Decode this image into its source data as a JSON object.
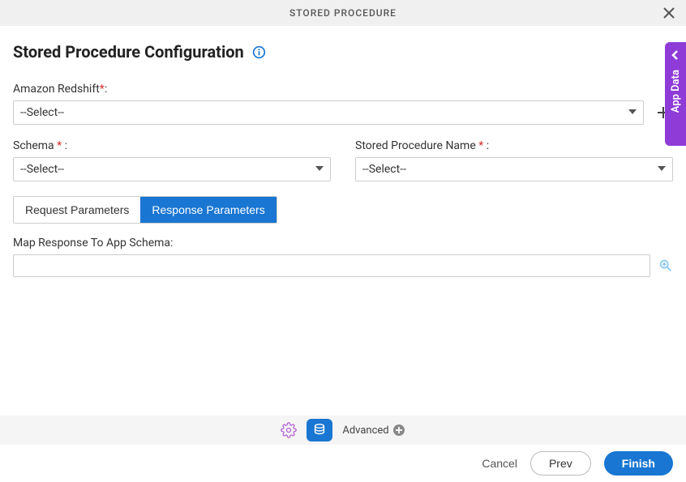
{
  "header": {
    "title": "STORED PROCEDURE"
  },
  "page": {
    "title": "Stored Procedure Configuration"
  },
  "fields": {
    "redshift": {
      "label": "Amazon Redshift",
      "value": "--Select--"
    },
    "schema": {
      "label": "Schema",
      "value": "--Select--"
    },
    "procName": {
      "label": "Stored Procedure Name",
      "value": "--Select--"
    },
    "mapResponse": {
      "label": "Map Response To App Schema:",
      "value": ""
    }
  },
  "tabs": {
    "request": "Request Parameters",
    "response": "Response Parameters"
  },
  "sideTab": {
    "label": "App Data"
  },
  "toolbar": {
    "advanced": "Advanced"
  },
  "footer": {
    "cancel": "Cancel",
    "prev": "Prev",
    "finish": "Finish"
  }
}
